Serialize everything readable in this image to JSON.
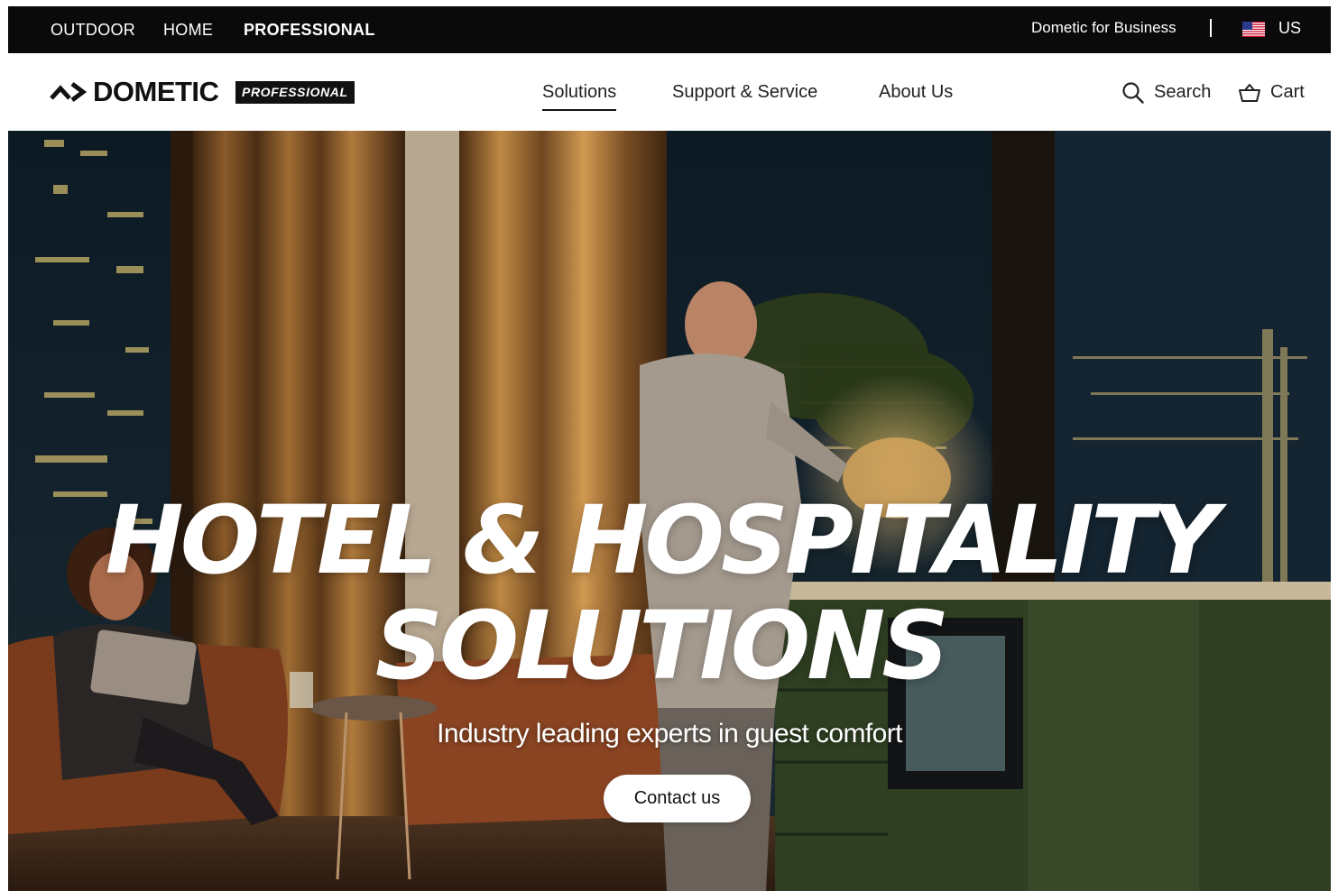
{
  "topbar": {
    "segments": [
      "OUTDOOR",
      "HOME",
      "PROFESSIONAL"
    ],
    "active_segment": "PROFESSIONAL",
    "business_link": "Dometic for Business",
    "country": "US",
    "flag_icon": "us-flag-icon"
  },
  "header": {
    "logo_word": "DOMETIC",
    "logo_badge": "PROFESSIONAL",
    "nav": [
      "Solutions",
      "Support & Service",
      "About Us"
    ],
    "active_nav": "Solutions",
    "search_label": "Search",
    "cart_label": "Cart"
  },
  "hero": {
    "title_line1": "HOTEL & HOSPITALITY",
    "title_line2": "SOLUTIONS",
    "subtitle": "Industry leading experts in guest comfort",
    "cta_label": "Contact us"
  },
  "colors": {
    "topbar_bg": "#0a0a0a",
    "header_bg": "#ffffff",
    "text_dark": "#111111",
    "hero_text": "#ffffff"
  }
}
